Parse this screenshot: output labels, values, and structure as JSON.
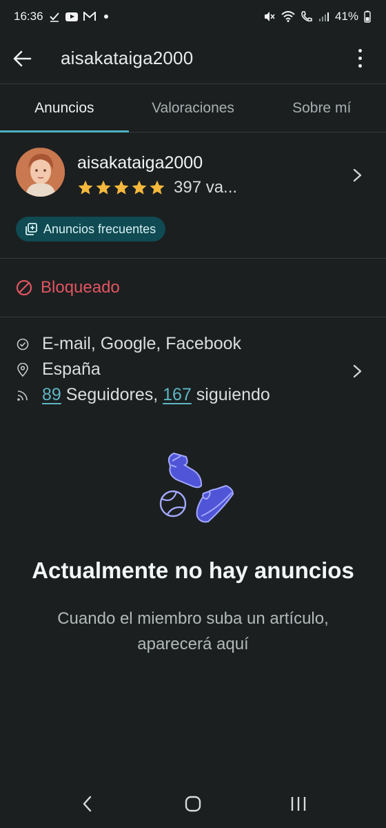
{
  "status_bar": {
    "time": "16:36",
    "battery": "41%",
    "icons": [
      "check-icon",
      "youtube-icon",
      "gmail-icon",
      "dot-icon",
      "mute-icon",
      "wifi-icon",
      "wifi-call-icon",
      "signal-icon"
    ]
  },
  "app_bar": {
    "title": "aisakataiga2000"
  },
  "tabs": [
    {
      "label": "Anuncios",
      "active": true
    },
    {
      "label": "Valoraciones",
      "active": false
    },
    {
      "label": "Sobre mí",
      "active": false
    }
  ],
  "profile": {
    "username": "aisakataiga2000",
    "stars": 5,
    "rating_text": "397 va...",
    "badge_label": "Anuncios frecuentes"
  },
  "blocked": {
    "label": "Bloqueado"
  },
  "info": {
    "verified": "E-mail, Google, Facebook",
    "location": "España",
    "followers_count": "89",
    "followers_label": " Seguidores, ",
    "following_count": "167",
    "following_label": " siguiendo"
  },
  "empty_state": {
    "title": "Actualmente no hay anuncios",
    "subtitle": "Cuando el miembro suba un artículo, aparecerá aquí"
  },
  "colors": {
    "background": "#1b1f20",
    "accent": "#4eb2c2",
    "danger": "#e35561",
    "star": "#f5b83d",
    "illustration": "#4f55d6"
  }
}
